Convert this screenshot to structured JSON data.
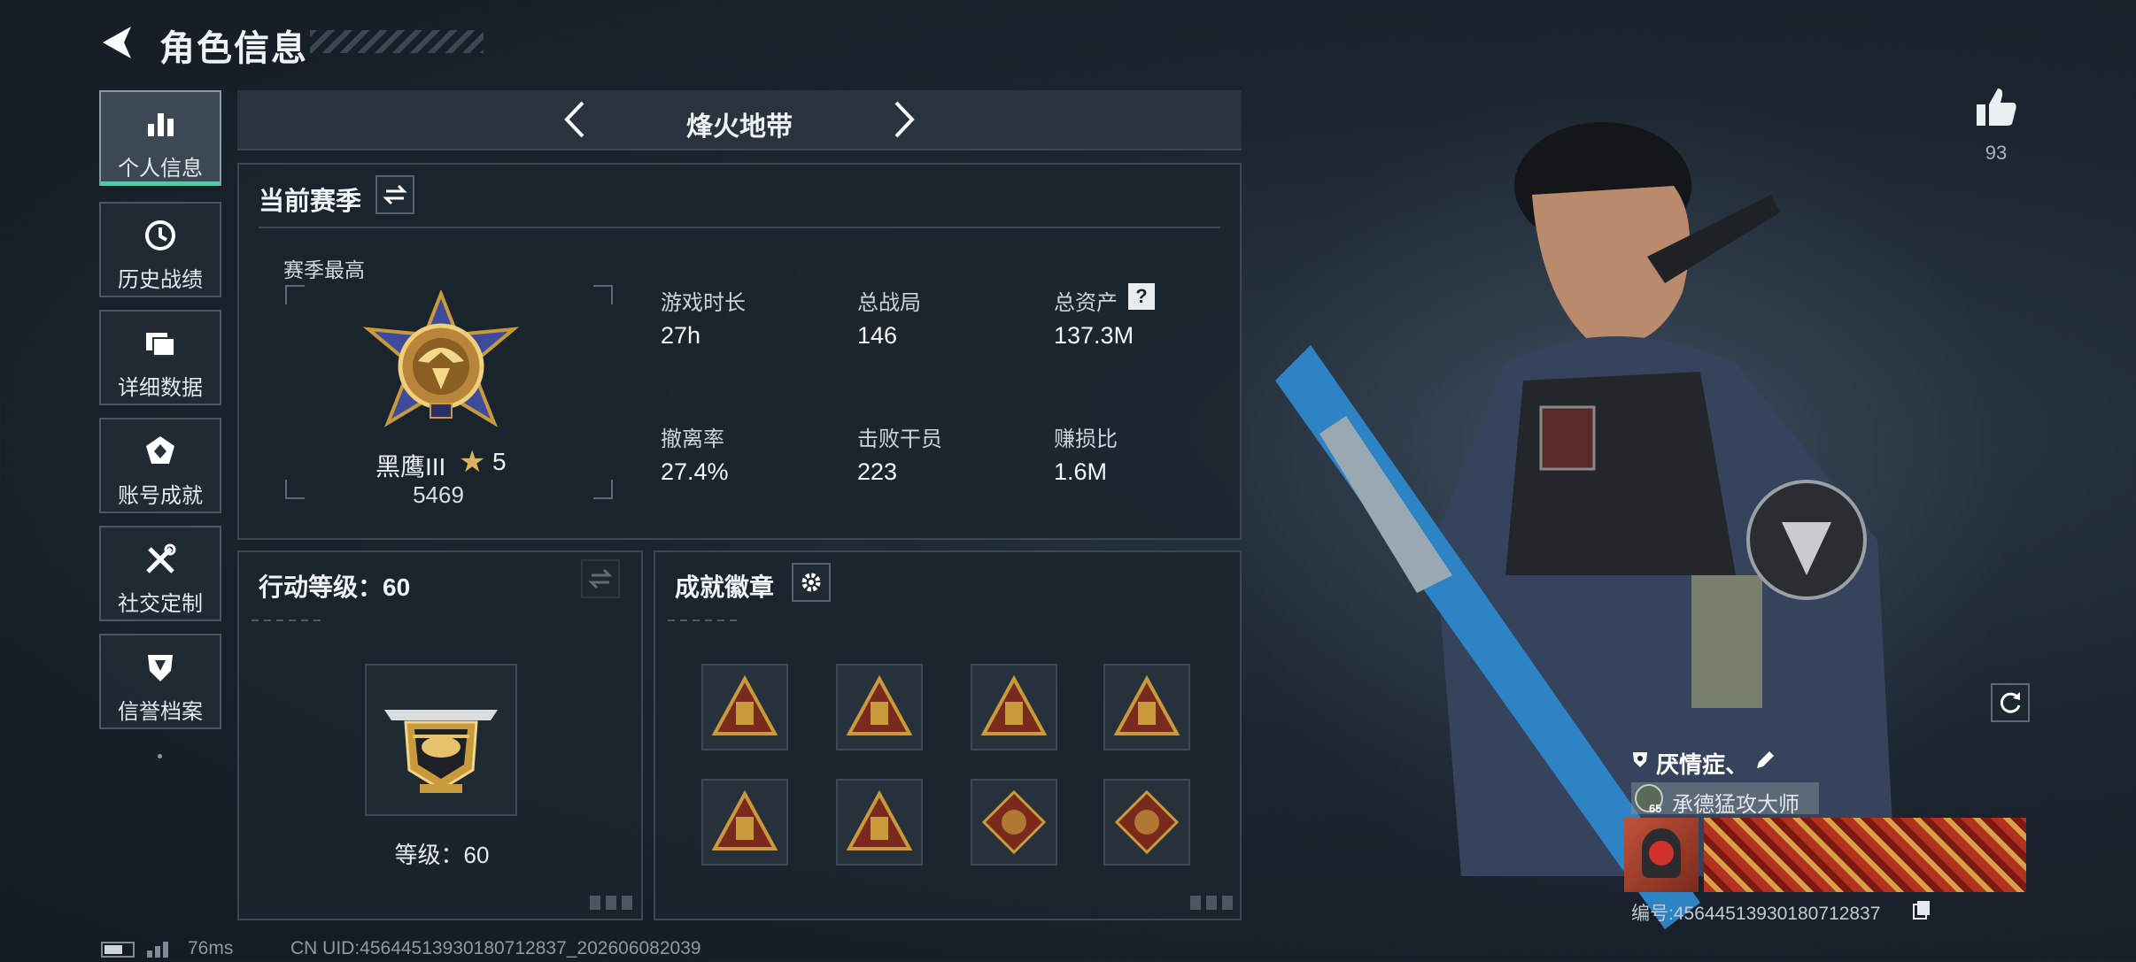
{
  "header": {
    "title": "角色信息"
  },
  "sidebar": {
    "items": [
      {
        "label": "个人信息",
        "icon": "bar-chart-icon",
        "active": true
      },
      {
        "label": "历史战绩",
        "icon": "history-icon"
      },
      {
        "label": "详细数据",
        "icon": "folder-icon"
      },
      {
        "label": "账号成就",
        "icon": "achievement-icon"
      },
      {
        "label": "社交定制",
        "icon": "tools-icon"
      },
      {
        "label": "信誉档案",
        "icon": "shield-icon"
      }
    ]
  },
  "mode_selector": {
    "title": "烽火地带"
  },
  "current_season": {
    "title": "当前赛季",
    "best_label": "赛季最高",
    "rank_name": "黑鹰III",
    "rank_stars": "5",
    "rank_points": "5469",
    "stats": [
      {
        "label": "游戏时长",
        "value": "27h"
      },
      {
        "label": "总战局",
        "value": "146"
      },
      {
        "label": "总资产",
        "value": "137.3M",
        "help": "?"
      },
      {
        "label": "撤离率",
        "value": "27.4%"
      },
      {
        "label": "击败干员",
        "value": "223"
      },
      {
        "label": "赚损比",
        "value": "1.6M"
      }
    ]
  },
  "action_level": {
    "title": "行动等级：60",
    "level_text": "等级：60"
  },
  "achievements": {
    "title": "成就徽章",
    "badge_count": 8
  },
  "likes": {
    "count": "93"
  },
  "profile_card": {
    "name": "厌情症、",
    "title_level": "65",
    "title_text": "承德猛攻大师",
    "id_text": "编号:4564451393018071283​7"
  },
  "status_bar": {
    "ping": "76ms",
    "uid": "CN UID:4564451393018071283​7_202606082039"
  },
  "colors": {
    "accent": "#39d6a8",
    "badge_gold": "#c89a3c",
    "badge_red": "#7a2a1c"
  }
}
